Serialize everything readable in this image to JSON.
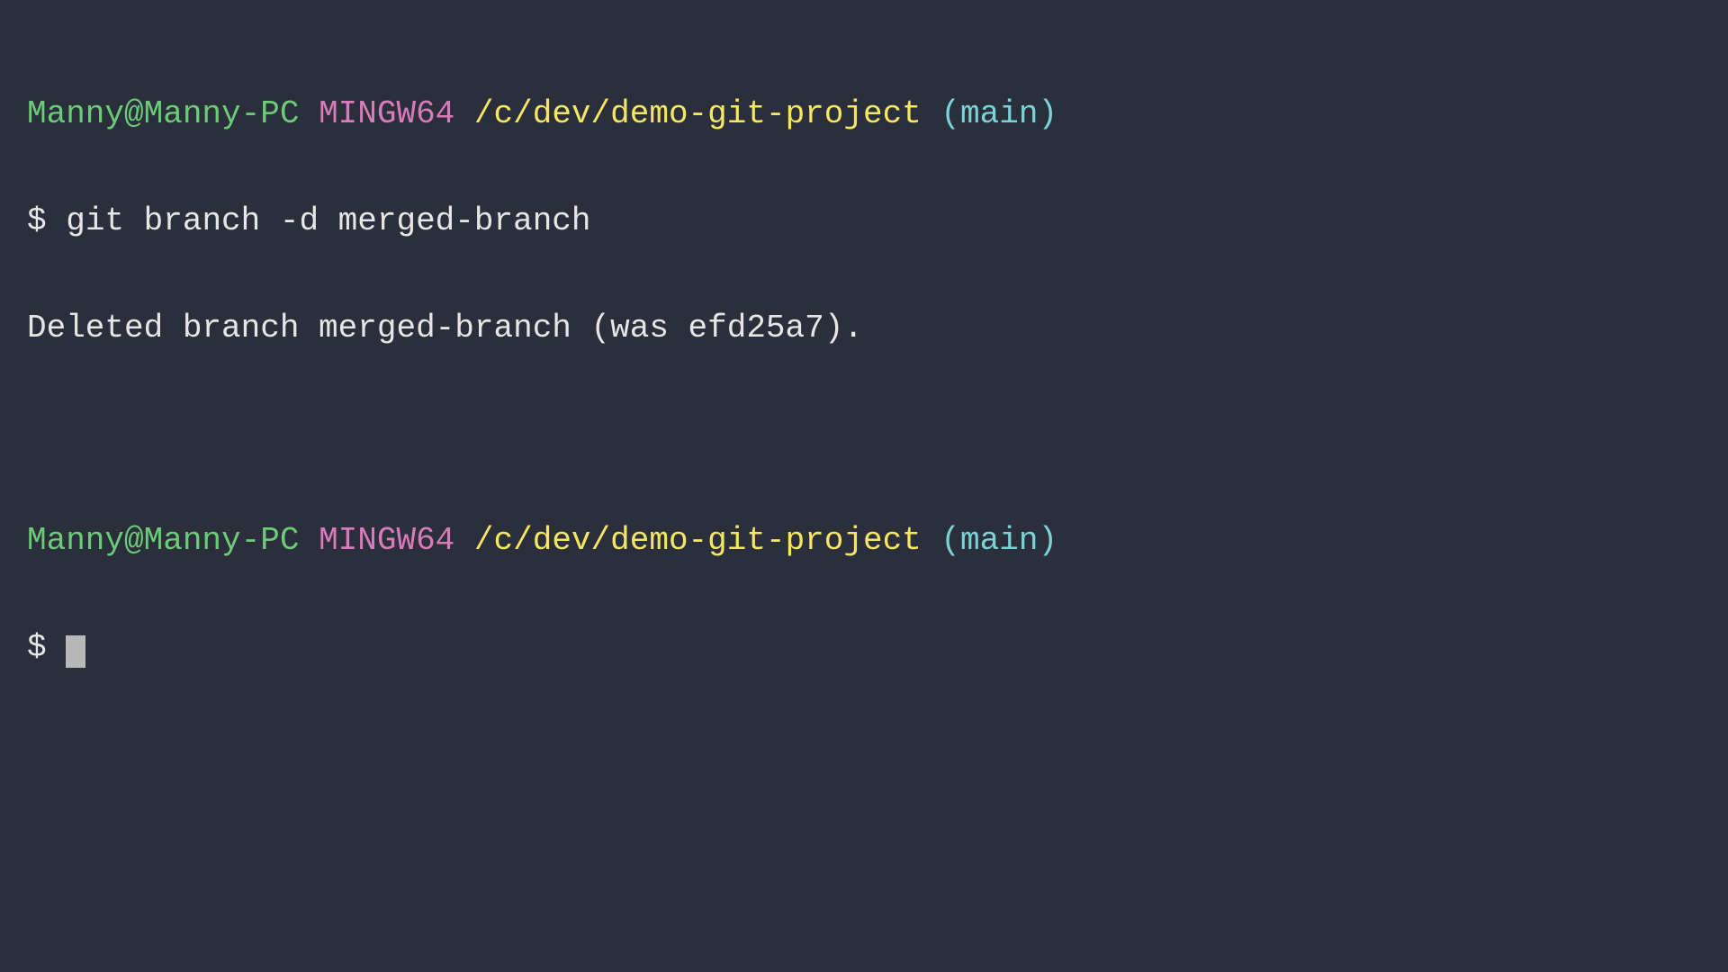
{
  "terminal": {
    "block1": {
      "prompt": {
        "user_host": "Manny@Manny-PC",
        "env": "MINGW64",
        "path": "/c/dev/demo-git-project",
        "branch": "(main)"
      },
      "symbol": "$",
      "command": "git branch -d merged-branch",
      "output": "Deleted branch merged-branch (was efd25a7)."
    },
    "block2": {
      "prompt": {
        "user_host": "Manny@Manny-PC",
        "env": "MINGW64",
        "path": "/c/dev/demo-git-project",
        "branch": "(main)"
      },
      "symbol": "$"
    }
  }
}
